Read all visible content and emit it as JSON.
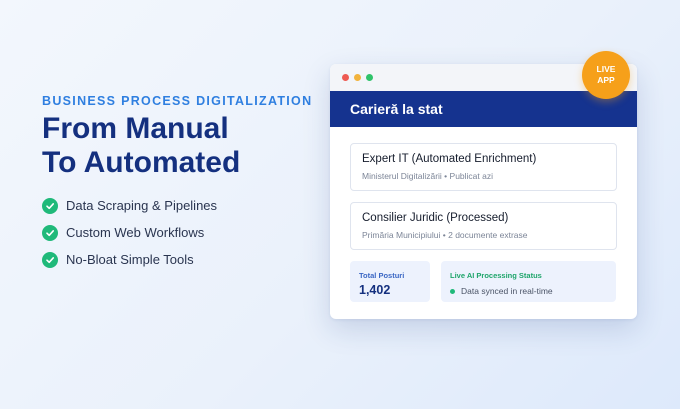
{
  "hero": {
    "eyebrow": "BUSINESS PROCESS DIGITALIZATION",
    "headline_line1": "From Manual",
    "headline_line2": "To Automated",
    "features": [
      "Data Scraping & Pipelines",
      "Custom Web Workflows",
      "No-Bloat Simple Tools"
    ]
  },
  "badge": {
    "line1": "LIVE",
    "line2": "APP"
  },
  "app": {
    "title": "Carieră la stat",
    "cards": [
      {
        "title": "Expert IT (Automated Enrichment)",
        "subtitle": "Ministerul Digitalizării • Publicat azi"
      },
      {
        "title": "Consilier Juridic (Processed)",
        "subtitle": "Primăria Municipiului • 2 documente extrase"
      }
    ],
    "stats": {
      "total_label": "Total Posturi",
      "total_value": "1,402",
      "status_label": "Live AI Processing Status",
      "status_text": "Data synced in real-time"
    }
  },
  "colors": {
    "brand_navy": "#15338f",
    "accent_blue": "#2f7fe0",
    "success_green": "#1fb97a",
    "badge_orange": "#f6a01a"
  },
  "icons": [
    "check-circle-icon",
    "window-close-dot",
    "window-minimize-dot",
    "window-maximize-dot",
    "live-status-dot-icon"
  ]
}
